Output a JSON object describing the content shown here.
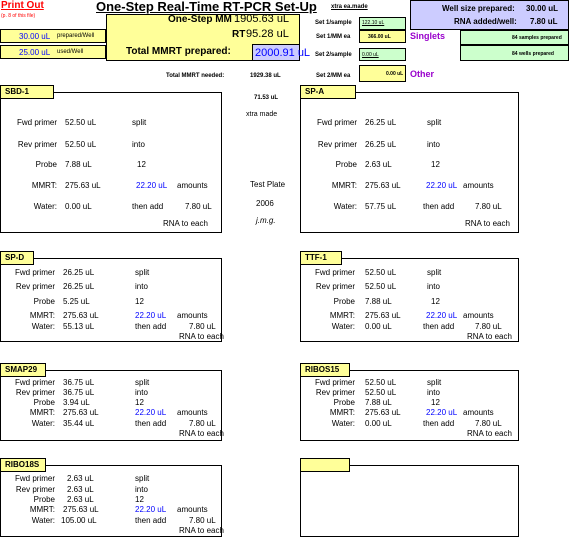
{
  "header": {
    "print_out": "Print Out",
    "page_note": "(p. 8 of this file)",
    "title": "One-Step Real-Time RT-PCR Set-Up",
    "onestep_mm_label": "One-Step MM",
    "onestep_mm_value": "1905.63 uL",
    "rt_label": "RT",
    "rt_value": "95.28 uL",
    "total_mmrt_label": "Total MMRT prepared:",
    "total_mmrt_value": "2000.91 uL",
    "prepared_well_value": "30.00 uL",
    "prepared_well_label": "prepared/Well",
    "used_well_value": "25.00 uL",
    "used_well_label": "used/Well",
    "xtra_made": "xtra ea.made",
    "set1_sample_label": "Set 1/sample",
    "set1_sample_value": "122.10 uL",
    "set1_mm_label": "Set 1/MM ea",
    "set1_mm_value": "366.00 uL",
    "singlets": "Singlets",
    "set2_sample_label": "Set 2/sample",
    "set2_sample_value": "0.00 uL",
    "set2_mm_label": "Set 2/MM ea",
    "set2_mm_value": "0.00 uL",
    "other": "Other",
    "well_size_label": "Well size prepared:",
    "well_size_value": "30.00 uL",
    "rna_added_label": "RNA added/well:",
    "rna_added_value": "7.80 uL",
    "samples_prepared": "84 samples prepared",
    "wells_prepared": "84 wells prepared",
    "total_needed_label": "Total MMRT needed:",
    "total_needed_value": "1929.38 uL",
    "extra_value": "71.53 uL",
    "extra_label": "xtra made",
    "test_plate": "Test Plate",
    "year": "2006",
    "initials": "j.m.g."
  },
  "labels": {
    "fwd": "Fwd primer",
    "rev": "Rev primer",
    "probe": "Probe",
    "mmrt": "MMRT:",
    "water": "Water:",
    "split": "split",
    "into": "into",
    "twelve": "12",
    "amounts": "amounts",
    "then_add": "then add",
    "rna_to_each": "RNA to each"
  },
  "panels": [
    {
      "name": "SBD-1",
      "fwd": "52.50 uL",
      "rev": "52.50 uL",
      "probe": "7.88 uL",
      "mmrt": "275.63 uL",
      "amount": "22.20 uL",
      "water": "0.00 uL",
      "rna": "7.80 uL"
    },
    {
      "name": "SP-A",
      "fwd": "26.25 uL",
      "rev": "26.25 uL",
      "probe": "2.63 uL",
      "mmrt": "275.63 uL",
      "amount": "22.20 uL",
      "water": "57.75 uL",
      "rna": "7.80 uL"
    },
    {
      "name": "SP-D",
      "fwd": "26.25 uL",
      "rev": "26.25 uL",
      "probe": "5.25 uL",
      "mmrt": "275.63 uL",
      "amount": "22.20 uL",
      "water": "55.13 uL",
      "rna": "7.80 uL"
    },
    {
      "name": "TTF-1",
      "fwd": "52.50 uL",
      "rev": "52.50 uL",
      "probe": "7.88 uL",
      "mmrt": "275.63 uL",
      "amount": "22.20 uL",
      "water": "0.00 uL",
      "rna": "7.80 uL"
    },
    {
      "name": "SMAP29",
      "fwd": "36.75 uL",
      "rev": "36.75 uL",
      "probe": "3.94 uL",
      "mmrt": "275.63 uL",
      "amount": "22.20 uL",
      "water": "35.44 uL",
      "rna": "7.80 uL"
    },
    {
      "name": "RIBOS15",
      "fwd": "52.50 uL",
      "rev": "52.50 uL",
      "probe": "7.88 uL",
      "mmrt": "275.63 uL",
      "amount": "22.20 uL",
      "water": "0.00 uL",
      "rna": "7.80 uL"
    },
    {
      "name": "RIBO18S",
      "fwd": "2.63 uL",
      "rev": "2.63 uL",
      "probe": "2.63 uL",
      "mmrt": "275.63 uL",
      "amount": "22.20 uL",
      "water": "105.00 uL",
      "rna": "7.80 uL"
    }
  ]
}
